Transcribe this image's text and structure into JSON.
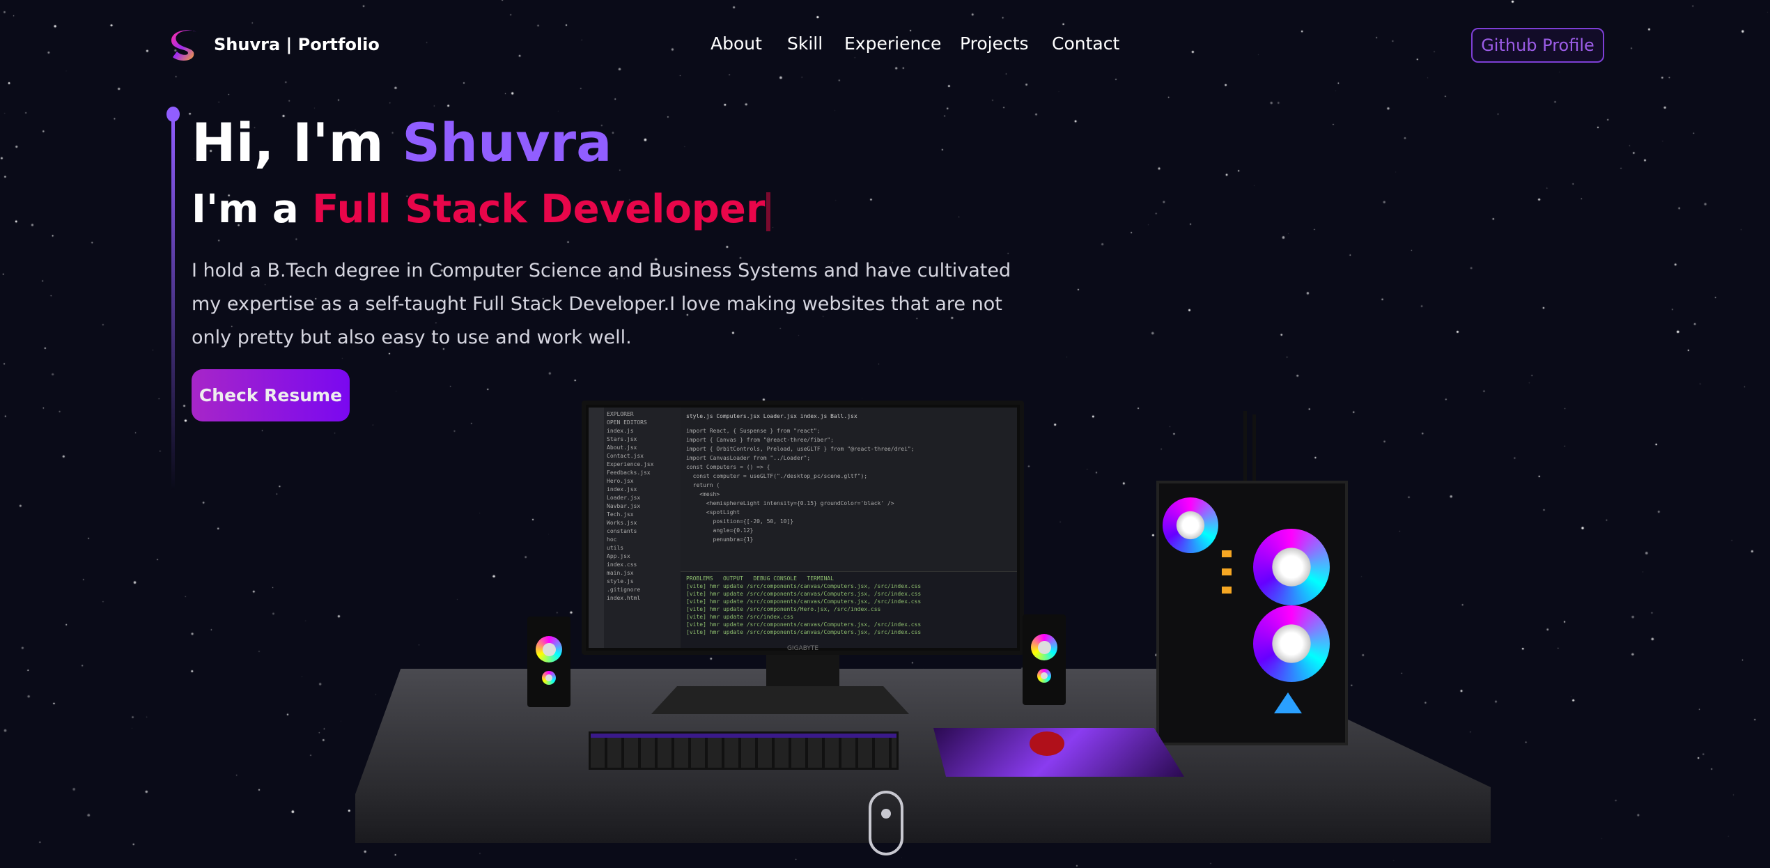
{
  "header": {
    "brand": "Shuvra | Portfolio",
    "nav": [
      "About",
      "Skill",
      "Experience",
      "Projects",
      "Contact"
    ],
    "github_label": "Github Profile"
  },
  "hero": {
    "greeting": "Hi, I'm ",
    "name": "Shuvra",
    "role_prefix": "I'm a ",
    "role": "Full Stack Developer",
    "description": "I hold a B.Tech degree in Computer Science and Business Systems and have cultivated my expertise as a self-taught Full Stack Developer.I love making websites that are not only pretty but also easy to use and work well.",
    "resume_label": "Check Resume"
  },
  "scene": {
    "editor_tabs": "style.js   Computers.jsx   Loader.jsx   index.js   Ball.jsx",
    "explorer": [
      "EXPLORER",
      "OPEN EDITORS",
      "index.js",
      "Stars.jsx",
      "About.jsx",
      "Contact.jsx",
      "Experience.jsx",
      "Feedbacks.jsx",
      "Hero.jsx",
      "index.jsx",
      "Loader.jsx",
      "Navbar.jsx",
      "Tech.jsx",
      "Works.jsx",
      "constants",
      "hoc",
      "utils",
      "App.jsx",
      "index.css",
      "main.jsx",
      "style.js",
      ".gitignore",
      "index.html"
    ],
    "code": [
      "import React, { Suspense } from \"react\";",
      "import { Canvas } from \"@react-three/fiber\";",
      "import { OrbitControls, Preload, useGLTF } from \"@react-three/drei\";",
      "",
      "import CanvasLoader from \"../Loader\";",
      "",
      "const Computers = () => {",
      "  const computer = useGLTF(\"./desktop_pc/scene.gltf\");",
      "",
      "  return (",
      "    <mesh>",
      "      <hemisphereLight intensity={0.15} groundColor='black' />",
      "      <spotLight",
      "        position={[-20, 50, 10]}",
      "        angle={0.12}",
      "        penumbra={1}"
    ],
    "terminal": [
      "PROBLEMS   OUTPUT   DEBUG CONSOLE   TERMINAL",
      "[vite] hmr update /src/components/canvas/Computers.jsx, /src/index.css",
      "[vite] hmr update /src/components/canvas/Computers.jsx, /src/index.css",
      "[vite] hmr update /src/components/canvas/Computers.jsx, /src/index.css",
      "[vite] hmr update /src/components/Hero.jsx, /src/index.css",
      "[vite] hmr update /src/index.css",
      "[vite] hmr update /src/components/canvas/Computers.jsx, /src/index.css",
      "[vite] hmr update /src/components/canvas/Computers.jsx, /src/index.css"
    ],
    "monitor_brand": "GIGABYTE"
  },
  "colors": {
    "accent": "#915eff",
    "role": "#e8064a",
    "background": "#0a0b18",
    "github": "#9b5ce6"
  }
}
